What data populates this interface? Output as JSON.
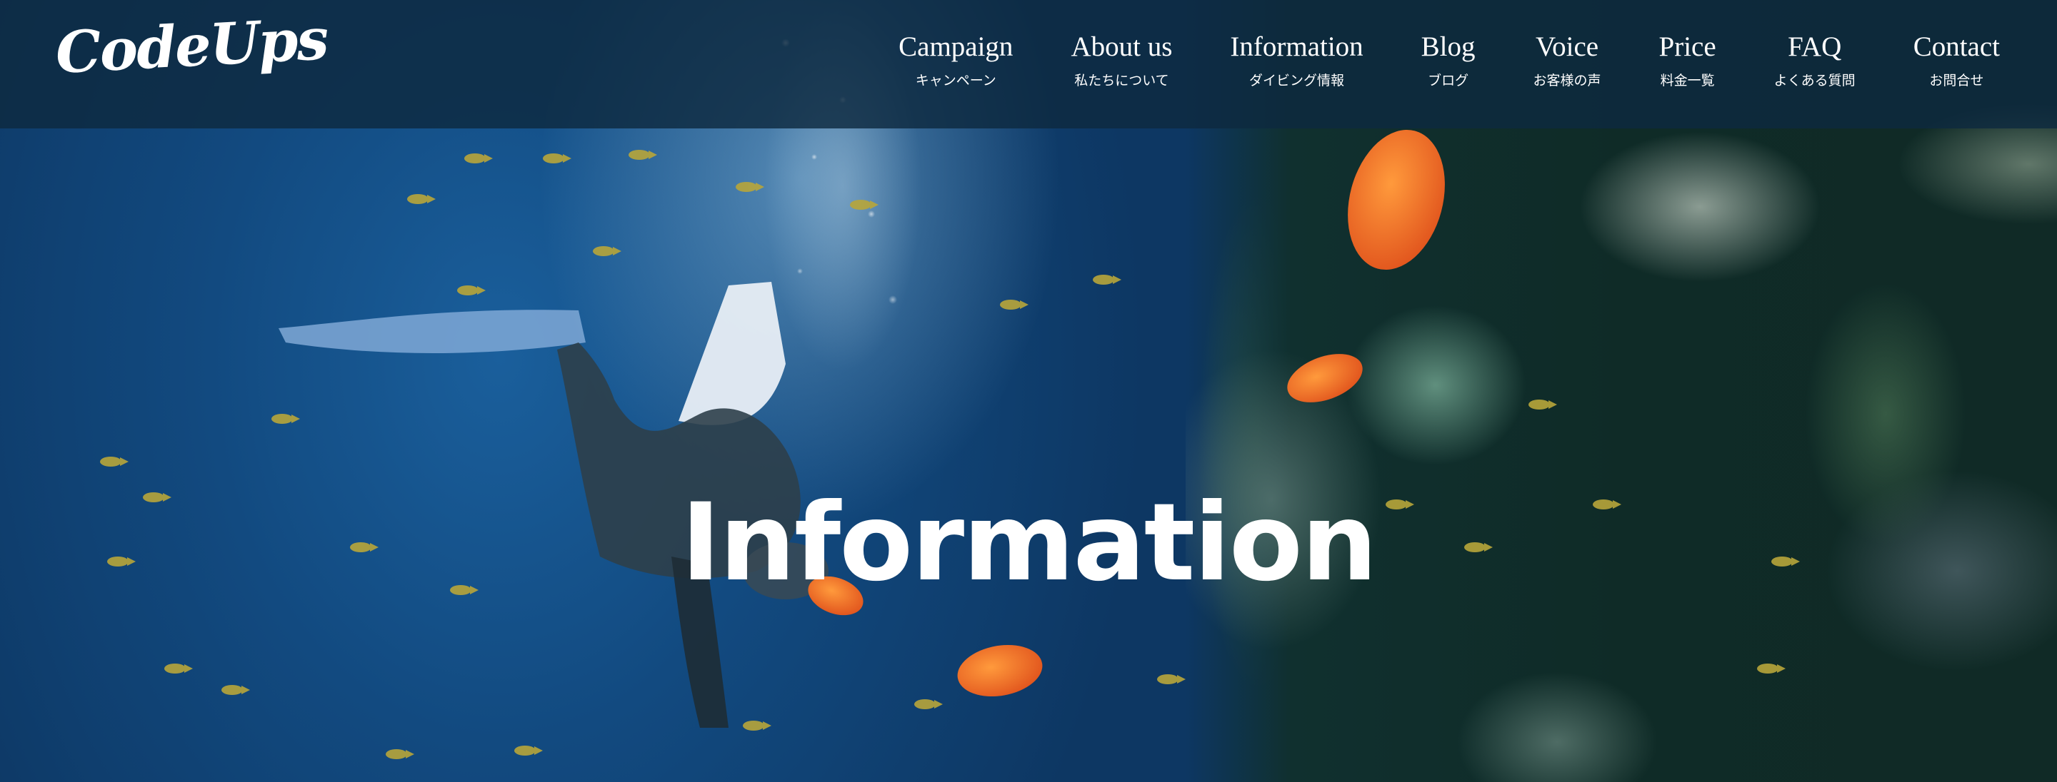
{
  "site": {
    "logo_text": "CodeUps"
  },
  "nav": {
    "items": [
      {
        "label": "Campaign",
        "sub": "キャンペーン"
      },
      {
        "label": "About us",
        "sub": "私たちについて"
      },
      {
        "label": "Information",
        "sub": "ダイビング情報"
      },
      {
        "label": "Blog",
        "sub": "ブログ"
      },
      {
        "label": "Voice",
        "sub": "お客様の声"
      },
      {
        "label": "Price",
        "sub": "料金一覧"
      },
      {
        "label": "FAQ",
        "sub": "よくある質問"
      },
      {
        "label": "Contact",
        "sub": "お問合せ"
      }
    ]
  },
  "hero": {
    "title": "Information"
  },
  "colors": {
    "header_bg": "#0d2940",
    "text": "#ffffff",
    "ocean": "#124a80",
    "reef": "#0f2b27"
  }
}
